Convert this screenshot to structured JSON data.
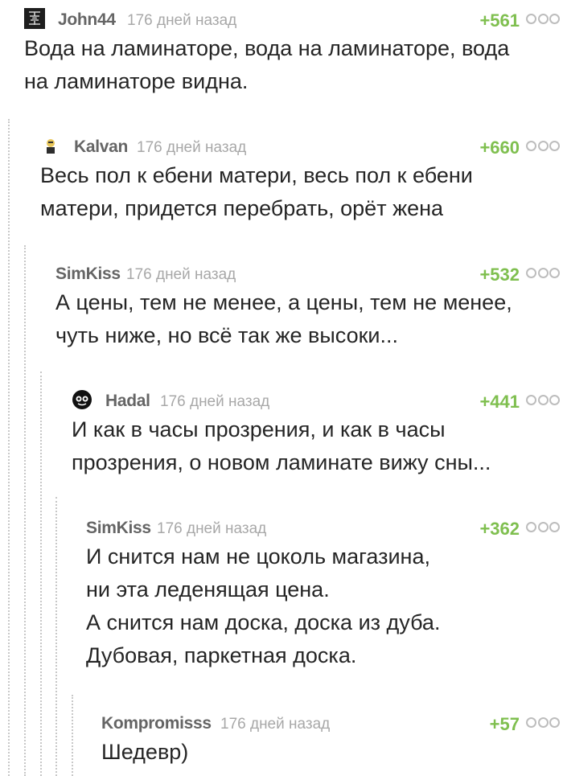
{
  "comments": [
    {
      "username": "John44",
      "time": "176 дней назад",
      "rating": "+561",
      "text": "Вода на ламинаторе, вода на ламинаторе, вода\nна ламинаторе видна."
    },
    {
      "username": "Kalvan",
      "time": "176 дней назад",
      "rating": "+660",
      "text": "Весь пол к ебени матери, весь пол к ебени\nматери, придется перебрать, орёт жена"
    },
    {
      "username": "SimKiss",
      "time": "176 дней назад",
      "rating": "+532",
      "text": "А цены, тем не менее, а цены, тем не менее,\nчуть ниже, но всё так же высоки..."
    },
    {
      "username": "Hadal",
      "time": "176 дней назад",
      "rating": "+441",
      "text": "И как в часы прозрения, и как в часы\nпрозрения, о новом ламинате вижу сны..."
    },
    {
      "username": "SimKiss",
      "time": "176 дней назад",
      "rating": "+362",
      "text": "И снится нам не цоколь магазина,\nни эта леденящая цена.\nА снится нам доска, доска из дуба.\nДубовая, паркетная доска."
    },
    {
      "username": "Kompromisss",
      "time": "176 дней назад",
      "rating": "+57",
      "text": "Шедевр)"
    }
  ]
}
